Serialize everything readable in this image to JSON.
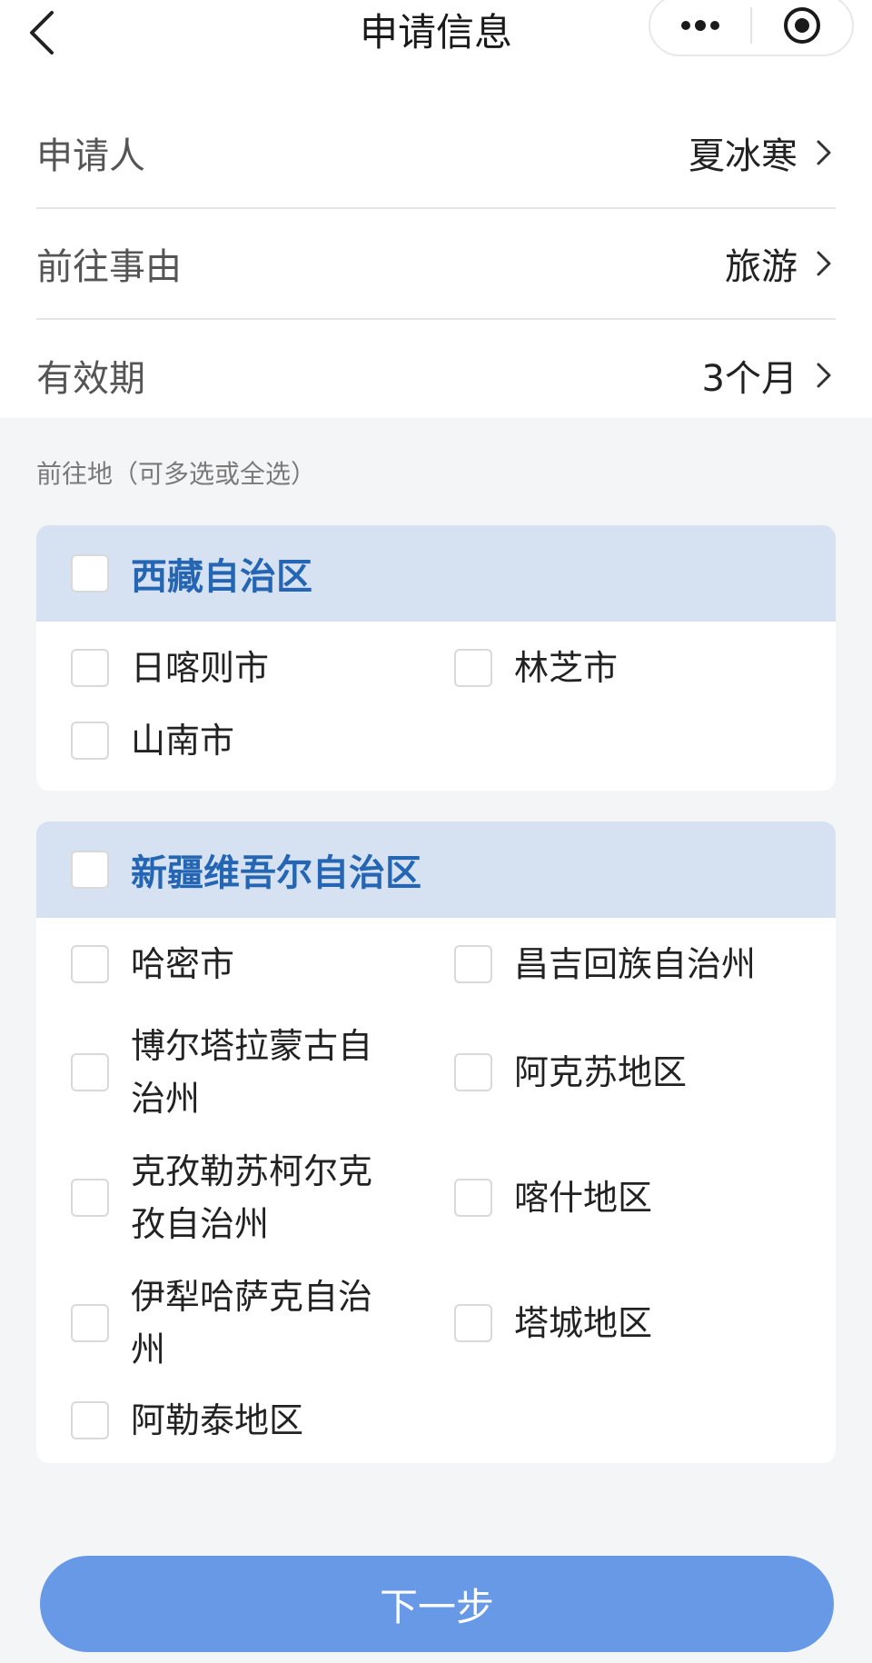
{
  "header": {
    "title": "申请信息",
    "back_icon": "chevron-left-icon",
    "more_icon": "more-dots-icon",
    "close_icon": "target-close-icon"
  },
  "info": {
    "applicant": {
      "label": "申请人",
      "value": "夏冰寒"
    },
    "reason": {
      "label": "前往事由",
      "value": "旅游"
    },
    "validity": {
      "label": "有效期",
      "value": "3个月"
    }
  },
  "destination": {
    "caption": "前往地（可多选或全选）",
    "regions": [
      {
        "name": "西藏自治区",
        "checked": false,
        "cities": [
          {
            "name": "日喀则市",
            "checked": false
          },
          {
            "name": "林芝市",
            "checked": false
          },
          {
            "name": "山南市",
            "checked": false
          }
        ]
      },
      {
        "name": "新疆维吾尔自治区",
        "checked": false,
        "cities": [
          {
            "name": "哈密市",
            "checked": false
          },
          {
            "name": "昌吉回族自治州",
            "checked": false
          },
          {
            "name": "博尔塔拉蒙古自治州",
            "checked": false
          },
          {
            "name": "阿克苏地区",
            "checked": false
          },
          {
            "name": "克孜勒苏柯尔克孜自治州",
            "checked": false
          },
          {
            "name": "喀什地区",
            "checked": false
          },
          {
            "name": "伊犁哈萨克自治州",
            "checked": false
          },
          {
            "name": "塔城地区",
            "checked": false
          },
          {
            "name": "阿勒泰地区",
            "checked": false
          }
        ]
      }
    ]
  },
  "footer": {
    "next_label": "下一步"
  },
  "colors": {
    "accent": "#2566b4",
    "region_header_bg": "#d6e2f2",
    "button_bg": "#6799e6",
    "page_bg": "#f4f5f7"
  }
}
